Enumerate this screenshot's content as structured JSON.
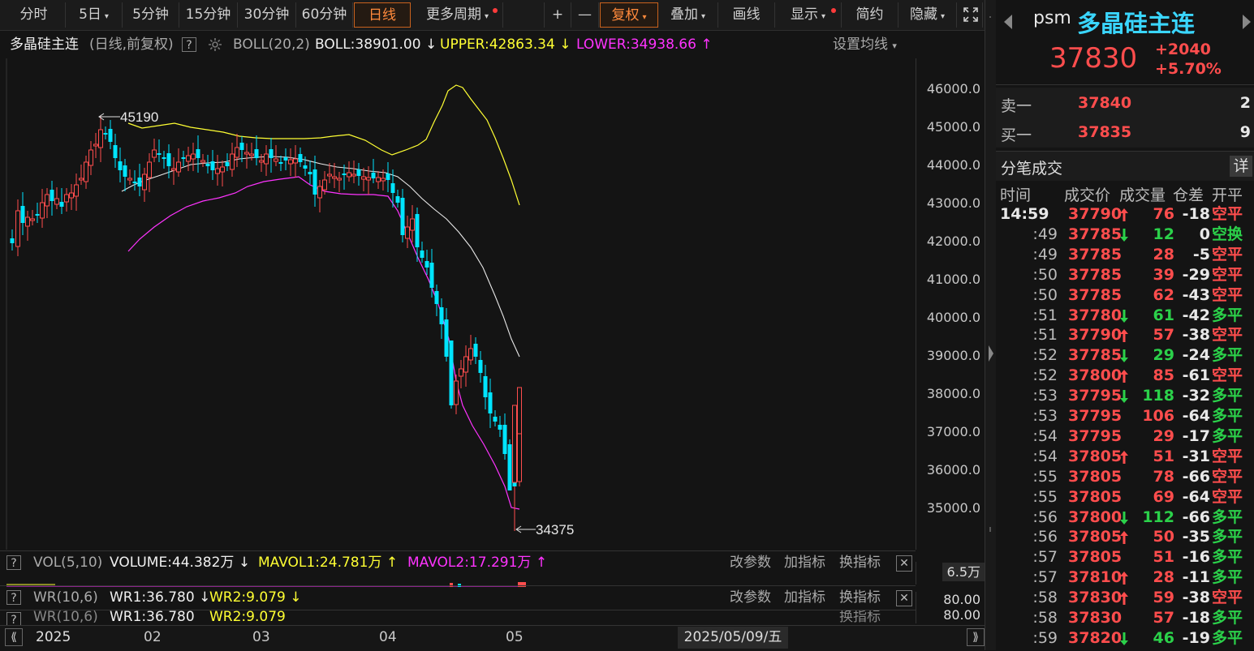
{
  "toolbar": {
    "tabs": [
      {
        "label": "分时"
      },
      {
        "label": "5日",
        "caret": "▾"
      },
      {
        "label": "5分钟"
      },
      {
        "label": "15分钟"
      },
      {
        "label": "30分钟"
      },
      {
        "label": "60分钟"
      },
      {
        "label": "日线",
        "active": true
      },
      {
        "label": "更多周期",
        "caret": "▾",
        "dot": true
      }
    ],
    "tools": [
      {
        "label": "+"
      },
      {
        "label": "—"
      },
      {
        "label": "复权",
        "caret": "▾",
        "active": true
      },
      {
        "label": "叠加",
        "caret": "▾"
      },
      {
        "label": "画线"
      },
      {
        "label": "显示",
        "caret": "▾",
        "dot": true
      },
      {
        "label": "简约"
      },
      {
        "label": "隐藏",
        "caret": "▾"
      }
    ]
  },
  "info": {
    "name": "多晶硅主连",
    "mode": "(日线,前复权)",
    "help": "?",
    "indicator": "BOLL(20,2)",
    "boll": "BOLL:38901.00",
    "boll_arrow": "↓",
    "upper": "UPPER:42863.34",
    "upper_arrow": "↓",
    "lower": "LOWER:34938.66",
    "lower_arrow": "↑",
    "settings": "设置均线",
    "settings_caret": "▾"
  },
  "chart_labels": {
    "high": "45190",
    "low": "34375"
  },
  "y_axis": [
    "46000.0",
    "45000.0",
    "44000.0",
    "43000.0",
    "42000.0",
    "41000.0",
    "40000.0",
    "39000.0",
    "38000.0",
    "37000.0",
    "36000.0",
    "35000.0"
  ],
  "vol_panel": {
    "help": "?",
    "name": "VOL(5,10)",
    "volume": "VOLUME:44.382万",
    "volume_arrow": "↓",
    "mavol1": "MAVOL1:24.781万",
    "mavol1_arrow": "↑",
    "mavol2": "MAVOL2:17.291万",
    "mavol2_arrow": "↑",
    "btn1": "改参数",
    "btn2": "加指标",
    "btn3": "换指标",
    "close": "✕",
    "axis_value": "6.5万"
  },
  "wr_panel": {
    "help": "?",
    "name": "WR(10,6)",
    "wr1": "WR1:36.780",
    "wr1_arrow": "↓",
    "wr2": "WR2:9.079",
    "wr2_arrow": "↓",
    "btn1": "改参数",
    "btn2": "加指标",
    "btn3": "换指标",
    "close": "✕",
    "axis_value": "80.00"
  },
  "wr_panel2": {
    "name": "WR(10,6)",
    "wr1": "WR1:36.780",
    "wr2": "WR2:9.079",
    "btn3": "换指标",
    "axis_value": "80.00"
  },
  "x_axis": {
    "labels": [
      "2025",
      "02",
      "03",
      "04",
      "05"
    ],
    "date": "2025/05/09/五"
  },
  "quote": {
    "code": "psm",
    "name": "多晶硅主连",
    "price": "37830",
    "change": "+2040",
    "change_pct": "+5.70%",
    "ask_label": "卖一",
    "ask_price": "37840",
    "ask_vol": "2",
    "bid_label": "买一",
    "bid_price": "37835",
    "bid_vol": "9"
  },
  "trades": {
    "title": "分笔成交",
    "detail": "详",
    "headers": [
      "时间",
      "成交价",
      "成交量",
      "仓差",
      "开平"
    ],
    "rows": [
      {
        "time": "14:59",
        "price": "37790",
        "dir": "up",
        "vol": "76",
        "diff": "-18",
        "type": "空平",
        "tc": "red"
      },
      {
        "time": ":49",
        "price": "37785",
        "dir": "down",
        "vol": "12",
        "diff": "0",
        "type": "空换",
        "tc": "green"
      },
      {
        "time": ":49",
        "price": "37785",
        "dir": "",
        "vol": "28",
        "diff": "-5",
        "type": "空平",
        "tc": "red"
      },
      {
        "time": ":50",
        "price": "37785",
        "dir": "",
        "vol": "39",
        "diff": "-29",
        "type": "空平",
        "tc": "red"
      },
      {
        "time": ":50",
        "price": "37785",
        "dir": "",
        "vol": "62",
        "diff": "-43",
        "type": "空平",
        "tc": "red"
      },
      {
        "time": ":51",
        "price": "37780",
        "dir": "down",
        "vol": "61",
        "diff": "-42",
        "type": "多平",
        "tc": "green"
      },
      {
        "time": ":51",
        "price": "37790",
        "dir": "up",
        "vol": "57",
        "diff": "-38",
        "type": "空平",
        "tc": "red"
      },
      {
        "time": ":52",
        "price": "37785",
        "dir": "down",
        "vol": "29",
        "diff": "-24",
        "type": "多平",
        "tc": "green"
      },
      {
        "time": ":52",
        "price": "37800",
        "dir": "up",
        "vol": "85",
        "diff": "-61",
        "type": "空平",
        "tc": "red"
      },
      {
        "time": ":53",
        "price": "37795",
        "dir": "down",
        "vol": "118",
        "diff": "-32",
        "type": "多平",
        "tc": "green"
      },
      {
        "time": ":53",
        "price": "37795",
        "dir": "",
        "vol": "106",
        "diff": "-64",
        "type": "多平",
        "tc": "green"
      },
      {
        "time": ":54",
        "price": "37795",
        "dir": "",
        "vol": "29",
        "diff": "-17",
        "type": "多平",
        "tc": "green"
      },
      {
        "time": ":54",
        "price": "37805",
        "dir": "up",
        "vol": "51",
        "diff": "-31",
        "type": "空平",
        "tc": "red"
      },
      {
        "time": ":55",
        "price": "37805",
        "dir": "",
        "vol": "78",
        "diff": "-66",
        "type": "空平",
        "tc": "red"
      },
      {
        "time": ":55",
        "price": "37805",
        "dir": "",
        "vol": "69",
        "diff": "-64",
        "type": "空平",
        "tc": "red"
      },
      {
        "time": ":56",
        "price": "37800",
        "dir": "down",
        "vol": "112",
        "diff": "-66",
        "type": "多平",
        "tc": "green"
      },
      {
        "time": ":56",
        "price": "37805",
        "dir": "up",
        "vol": "50",
        "diff": "-35",
        "type": "多平",
        "tc": "green"
      },
      {
        "time": ":57",
        "price": "37805",
        "dir": "",
        "vol": "51",
        "diff": "-16",
        "type": "多平",
        "tc": "green"
      },
      {
        "time": ":57",
        "price": "37810",
        "dir": "up",
        "vol": "28",
        "diff": "-11",
        "type": "多平",
        "tc": "green"
      },
      {
        "time": ":58",
        "price": "37830",
        "dir": "up",
        "vol": "59",
        "diff": "-38",
        "type": "空平",
        "tc": "red"
      },
      {
        "time": ":58",
        "price": "37830",
        "dir": "",
        "vol": "57",
        "diff": "-18",
        "type": "多平",
        "tc": "green"
      },
      {
        "time": ":59",
        "price": "37820",
        "dir": "down",
        "vol": "46",
        "diff": "-19",
        "type": "多平",
        "tc": "green"
      }
    ]
  },
  "colors": {
    "up": "#ff4d4d",
    "down": "#00e5ff",
    "boll_mid": "#e8e8e8",
    "boll_upper": "#ffff33",
    "boll_lower": "#ff33ff",
    "accent": "#ff8a3c",
    "quote_name": "#3ad6ff"
  },
  "icons": {
    "settings": "gear-icon",
    "fullscreen": "fullscreen-icon",
    "prev": "triangle-left-icon",
    "next": "triangle-right-icon"
  }
}
